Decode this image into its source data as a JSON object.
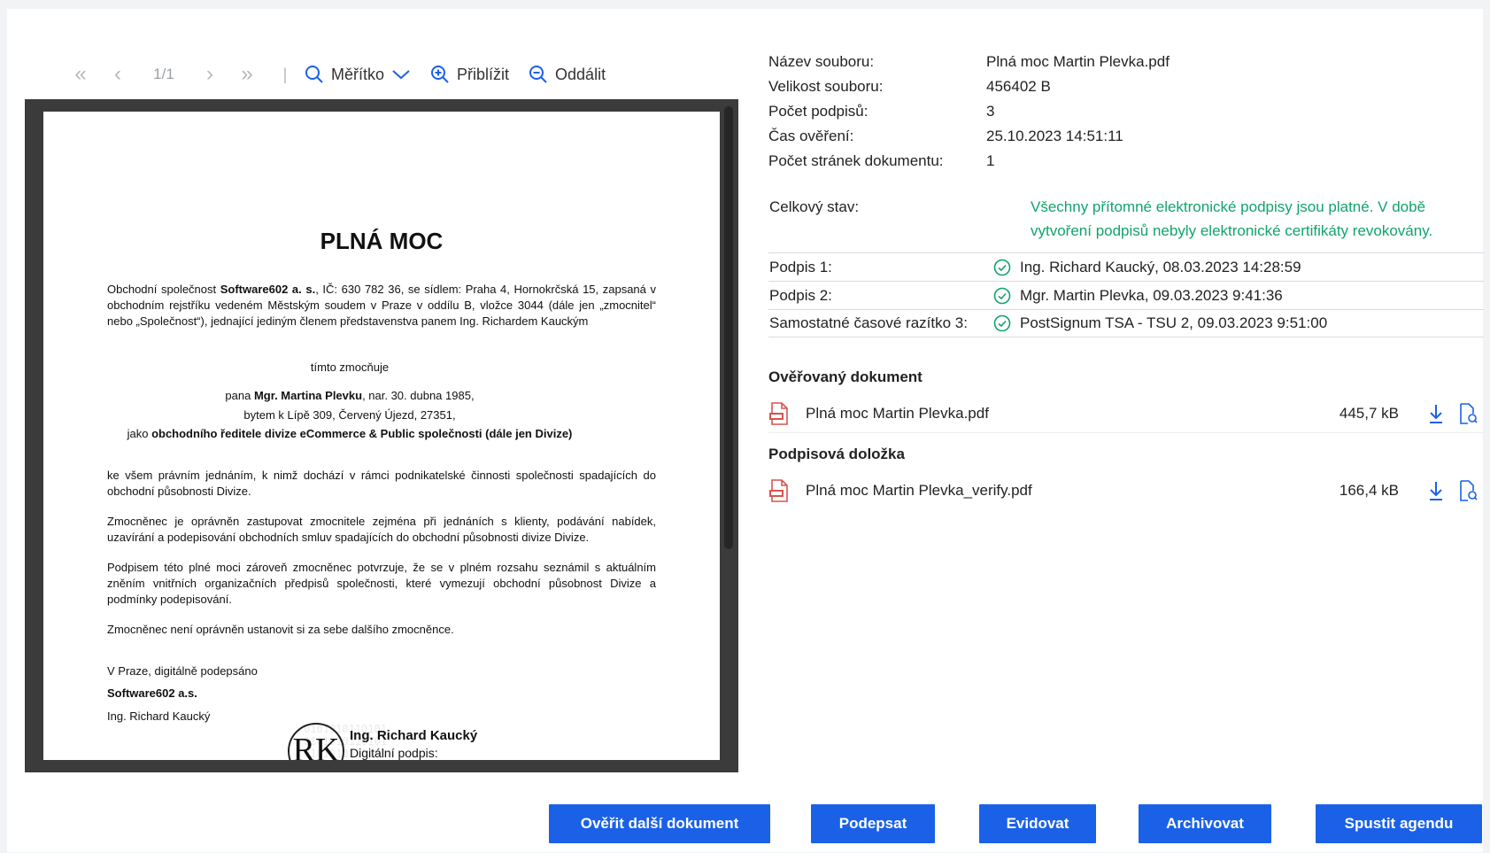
{
  "toolbar": {
    "page_indicator": "1/1",
    "scale_label": "Měřítko",
    "zoom_in_label": "Přiblížit",
    "zoom_out_label": "Oddálit"
  },
  "document": {
    "title": "PLNÁ MOC",
    "p1_a": "Obchodní společnost ",
    "p1_company": "Software602 a. s.",
    "p1_b": ", IČ: 630 782 36, se sídlem: Praha 4, Hornokrčská 15, zapsaná v obchodním rejstříku vedeném Městským soudem v Praze v oddílu B, vložce 3044 (dále jen „zmocnitel“ nebo „Společnost“), jednající jediným členem představenstva panem Ing. Richardem Kauckým",
    "authorizes": "tímto zmocňuje",
    "person_a": "pana ",
    "person_name": "Mgr. Martina Plevku",
    "person_b": ", nar. 30. dubna 1985,",
    "address": "bytem k Lípě 309, Červený Újezd, 27351,",
    "role_a": "jako ",
    "role_b": "obchodního ředitele divize eCommerce & Public společnosti (dále jen Divize)",
    "p2": "ke všem právním jednáním, k nimž dochází v rámci podnikatelské činnosti společnosti spadajících do obchodní působnosti Divize.",
    "p3": "Zmocněnec je oprávněn zastupovat zmocnitele zejména při jednáních s klienty, podávání nabídek, uzavírání a podepisování obchodních smluv spadajících do obchodní působnosti divize Divize.",
    "p4": "Podpisem této plné moci zároveň zmocněnec potvrzuje, že se v plném rozsahu seznámil s aktuálním zněním vnitřních organizačních předpisů společnosti, které vymezují obchodní působnost Divize a podmínky podepisování.",
    "p5": "Zmocněnec není oprávněn ustanovit si za sebe dalšího zmocněnce.",
    "place": "V Praze, digitálně podepsáno",
    "signer_company": "Software602 a.s.",
    "signer_person": "Ing. Richard Kaucký",
    "stamp_name": "Ing. Richard Kaucký",
    "stamp_line": "Digitální podpis:",
    "stamp_watermark": "0101010110101",
    "stamp_monogram": "RK"
  },
  "info": {
    "file_name_label": "Název souboru:",
    "file_name": "Plná moc Martin Plevka.pdf",
    "file_size_label": "Velikost souboru:",
    "file_size": "456402 B",
    "signature_count_label": "Počet podpisů:",
    "signature_count": "3",
    "verify_time_label": "Čas ověření:",
    "verify_time": "25.10.2023 14:51:11",
    "page_count_label": "Počet stránek dokumentu:",
    "page_count": "1",
    "state_label": "Celkový stav:",
    "state_value": "Všechny přítomné elektronické podpisy jsou platné. V době vytvoření podpisů nebyly elektronické certifikáty revokovány.",
    "state_color": "#12a36b"
  },
  "signatures": [
    {
      "label": "Podpis 1:",
      "value": "Ing. Richard Kaucký, 08.03.2023 14:28:59"
    },
    {
      "label": "Podpis 2:",
      "value": "Mgr. Martin Plevka, 09.03.2023 9:41:36"
    },
    {
      "label": "Samostatné časové razítko 3:",
      "value": "PostSignum TSA - TSU 2, 09.03.2023 9:51:00"
    }
  ],
  "verified_doc": {
    "title": "Ověřovaný dokument",
    "file_name": "Plná moc Martin Plevka.pdf",
    "file_size": "445,7 kB"
  },
  "signature_clause": {
    "title": "Podpisová doložka",
    "file_name": "Plná moc Martin Plevka_verify.pdf",
    "file_size": "166,4 kB"
  },
  "buttons": {
    "verify_other": "Ověřit další dokument",
    "sign": "Podepsat",
    "register": "Evidovat",
    "archive": "Archivovat",
    "run_agenda": "Spustit agendu"
  },
  "colors": {
    "accent": "#1a61e8",
    "valid": "#12a36b",
    "pdf_icon": "#d9534f"
  },
  "icons": [
    "first-page-icon",
    "prev-page-icon",
    "next-page-icon",
    "last-page-icon",
    "search-icon",
    "chevron-down-icon",
    "zoom-in-icon",
    "zoom-out-icon",
    "check-circle-icon",
    "pdf-file-icon",
    "download-icon",
    "file-detail-icon"
  ]
}
